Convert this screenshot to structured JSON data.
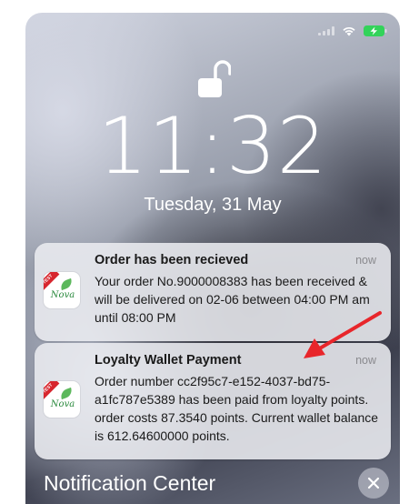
{
  "status_bar": {
    "icons": [
      "cellular-signal-icon",
      "wifi-icon",
      "battery-charging-icon"
    ],
    "battery_color": "#33d35a"
  },
  "lock_screen": {
    "lock_icon": "unlocked-padlock-icon",
    "time": "11:32",
    "date": "Tuesday, 31 May"
  },
  "notifications": [
    {
      "app_icon": "nova-app-icon",
      "icon_badge": "TEST",
      "icon_brand": "Nova",
      "title": "Order has been recieved",
      "time": "now",
      "body": "Your order No.9000008383 has been received & will be delivered on 02-06 between 04:00 PM am until 08:00 PM"
    },
    {
      "app_icon": "nova-app-icon",
      "icon_badge": "TEST",
      "icon_brand": "Nova",
      "title": "Loyalty Wallet Payment",
      "time": "now",
      "body": "Order number cc2f95c7-e152-4037-bd75-a1fc787e5389 has been paid from loyalty points. order costs 87.3540 points. Current wallet balance is 612.64600000 points."
    }
  ],
  "annotation": {
    "icon": "red-arrow-icon",
    "color": "#e8262b"
  },
  "notification_center": {
    "title": "Notification Center",
    "close_icon": "close-icon"
  }
}
